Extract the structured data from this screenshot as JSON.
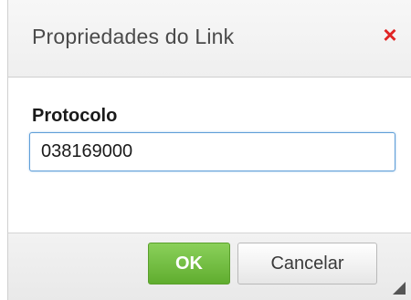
{
  "dialog": {
    "title": "Propriedades do Link",
    "close_glyph": "×",
    "field_label": "Protocolo",
    "field_value": "038169000",
    "ok_label": "OK",
    "cancel_label": "Cancelar"
  },
  "colors": {
    "close": "#e02424",
    "ok_button": "#6cbb3c",
    "input_focus_border": "#5e9ed8"
  },
  "icons": {
    "close": "close-icon",
    "resize": "resize-handle-icon"
  }
}
